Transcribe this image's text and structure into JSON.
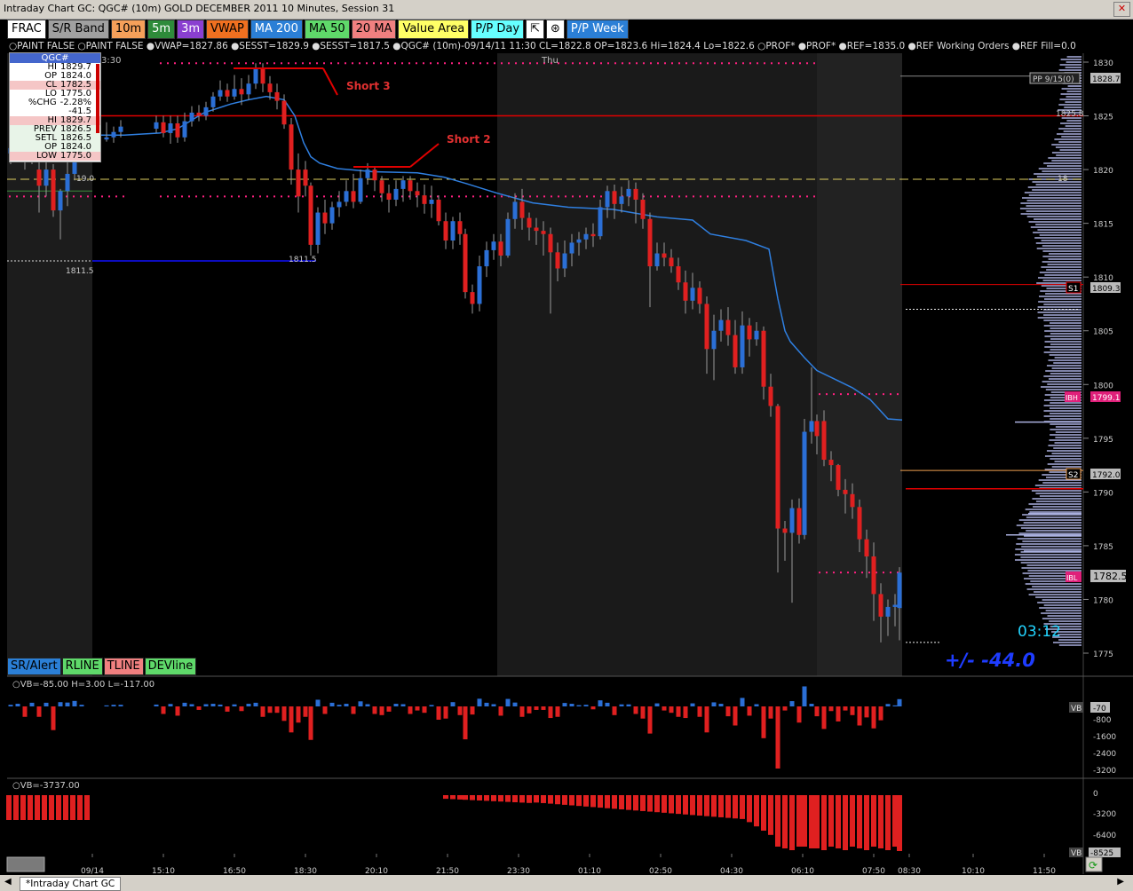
{
  "window": {
    "title": "Intraday Chart GC: QGC# (10m) GOLD DECEMBER 2011 10 Minutes, Session 31"
  },
  "toolbar": [
    {
      "label": "FRAC",
      "bg": "#ffffff"
    },
    {
      "label": "S/R Band",
      "bg": "#a0a0a0"
    },
    {
      "label": "10m",
      "bg": "#f5a05a"
    },
    {
      "label": "5m",
      "bg": "#2e8b3a"
    },
    {
      "label": "3m",
      "bg": "#8a3fd0"
    },
    {
      "label": "VWAP",
      "bg": "#f07020"
    },
    {
      "label": "MA 200",
      "bg": "#2b7fd6"
    },
    {
      "label": "MA 50",
      "bg": "#5fd96a"
    },
    {
      "label": "20 MA",
      "bg": "#f08080"
    },
    {
      "label": "Value Area",
      "bg": "#ffff66"
    },
    {
      "label": "P/P Day",
      "bg": "#66ffff"
    },
    {
      "label": "⇱",
      "bg": "#ffffff"
    },
    {
      "label": "⊛",
      "bg": "#ffffff"
    },
    {
      "label": "P/P Week",
      "bg": "#2b7fd6"
    }
  ],
  "info_strip": "○PAINT FALSE ○PAINT FALSE ●VWAP=1827.86 ●SESST=1829.9 ●SESST=1817.5 ●QGC# (10m)-09/14/11 11:30 CL=1822.8 OP=1823.6 Hi=1824.4 Lo=1822.6 ○PROF* ●PROF* ●REF=1835.0 ●REF Working Orders ●REF Fill=0.0",
  "quote": {
    "symbol": "QGC#",
    "rows": [
      {
        "label": "HI",
        "value": "1829.7",
        "style": ""
      },
      {
        "label": "OP",
        "value": "1824.0",
        "style": ""
      },
      {
        "label": "CL",
        "value": "1782.5",
        "style": "pink"
      },
      {
        "label": "LO",
        "value": "1775.0",
        "style": ""
      },
      {
        "label": "%CHG",
        "value": "-2.28%",
        "style": ""
      },
      {
        "label": "",
        "value": "-41.5",
        "style": ""
      },
      {
        "label": "HI",
        "value": "1829.7",
        "style": "pink"
      },
      {
        "label": "PREV",
        "value": "1826.5",
        "style": "green"
      },
      {
        "label": "SETL",
        "value": "1826.5",
        "style": "green"
      },
      {
        "label": "OP",
        "value": "1824.0",
        "style": "green"
      },
      {
        "label": "LOW",
        "value": "1775.0",
        "style": "pink"
      }
    ]
  },
  "annotations": {
    "short3": "Short 3",
    "short2": "Short 2",
    "session_time": "3:30",
    "day_label": "Thu",
    "level_1811": "1811.5",
    "level_1811b": "1811.5",
    "level_1819": "19.0",
    "level_1825_label": "1825.8",
    "pp_label": "PP 9/15(0)",
    "pp_price": "1828.7",
    "s1_tag": "S1",
    "s1_price": "1809.3",
    "ibh_tag": "IBH",
    "ibh_price": "1799.1",
    "s2_tag": "S2",
    "s2_price": "1792.0",
    "ibl_tag": "IBL",
    "last_price": "1782.5",
    "countdown": "03:12",
    "range_text": "+/-    -44.0",
    "r_18": "18"
  },
  "price_axis": [
    "1830",
    "1825",
    "1820",
    "1815",
    "1810",
    "1805",
    "1800",
    "1795",
    "1790",
    "1785",
    "1780",
    "1775"
  ],
  "alert_toolbar": [
    {
      "label": "SR/Alert",
      "bg": "#2b7fd6"
    },
    {
      "label": "RLINE",
      "bg": "#5fd96a"
    },
    {
      "label": "TLINE",
      "bg": "#f08080"
    },
    {
      "label": "DEVline",
      "bg": "#5fd96a"
    }
  ],
  "vb_panel": {
    "header": "○VB=-85.00 H=3.00 L=-117.00",
    "tag": "VB",
    "tag_value": "-70",
    "axis": [
      "-800",
      "-1600",
      "-2400",
      "-3200"
    ]
  },
  "cvb_panel": {
    "header": "○VB=-3737.00",
    "axis": [
      "0",
      "-3200",
      "-6400"
    ],
    "tag": "VB",
    "tag_value": "-8525"
  },
  "time_axis": [
    "09/14",
    "15:10",
    "16:50",
    "18:30",
    "20:10",
    "21:50",
    "23:30",
    "01:10",
    "02:50",
    "04:30",
    "06:10",
    "07:50",
    "08:30",
    "10:10",
    "11:50"
  ],
  "bottom_tab": "*Intraday Chart GC",
  "colors": {
    "up": "#2b6fd6",
    "down": "#e02020",
    "vwap": "#2f7fe0",
    "level_red": "#e00000",
    "level_blue": "#1010ff",
    "dots": "#ff2080",
    "yellow_dash": "#e0d060",
    "profile": "#aab0e0",
    "countdown": "#22d4ff",
    "range": "#1e3cff"
  }
}
